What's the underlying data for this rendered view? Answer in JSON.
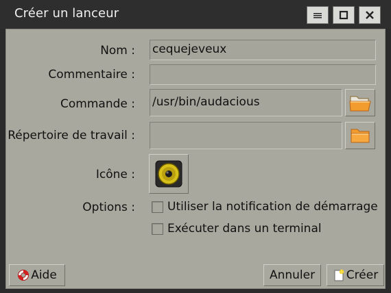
{
  "window": {
    "title": "Créer un lanceur"
  },
  "titlebar_buttons": [
    {
      "name": "minimize-icon"
    },
    {
      "name": "maximize-icon"
    },
    {
      "name": "close-icon"
    }
  ],
  "form": {
    "name_label": "Nom :",
    "name_value": "cequejeveux",
    "comment_label": "Commentaire :",
    "comment_value": "",
    "command_label": "Commande :",
    "command_value": "/usr/bin/audacious",
    "workdir_label": "Répertoire de travail :",
    "workdir_value": "",
    "icon_label": "Icône :",
    "options_label": "Options :",
    "option_startup_notify": "Utiliser la notification de démarrage",
    "option_terminal": "Exécuter dans un terminal",
    "option_startup_notify_checked": false,
    "option_terminal_checked": false
  },
  "buttons": {
    "help": "Aide",
    "cancel": "Annuler",
    "create": "Créer"
  },
  "colors": {
    "titlebar": "#2e2e2e",
    "dialog_bg": "#a9a89e",
    "folder_orange": "#f29b2e",
    "speaker_yellow": "#d8c01a"
  }
}
